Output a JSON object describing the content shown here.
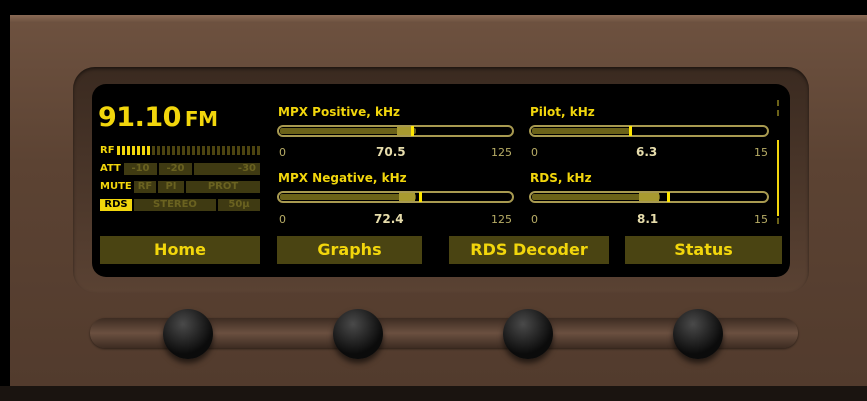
{
  "station": {
    "frequency": "91.10",
    "band": "FM"
  },
  "indicators": {
    "rf": "RF",
    "att": "ATT",
    "att_levels": [
      "-10",
      "-20",
      "-30"
    ],
    "mute": "MUTE",
    "mute_flags": [
      "RF",
      "PI",
      "PROT"
    ],
    "rds": "RDS",
    "stereo": "STEREO",
    "deemphasis": "50μ"
  },
  "meters": [
    {
      "label": "MPX Positive, kHz",
      "min": "0",
      "max": "125",
      "value": "70.5",
      "fraction": 0.564
    },
    {
      "label": "Pilot, kHz",
      "min": "0",
      "max": "15",
      "value": "6.3",
      "fraction": 0.42
    },
    {
      "label": "MPX Negative, kHz",
      "min": "0",
      "max": "125",
      "value": "72.4",
      "fraction": 0.579
    },
    {
      "label": "RDS, kHz",
      "min": "0",
      "max": "15",
      "value": "8.1",
      "fraction": 0.54
    }
  ],
  "softkeys": [
    "Home",
    "Graphs",
    "RDS Decoder",
    "Status"
  ],
  "colors": {
    "accent": "#f2d60c",
    "screen": "#000000",
    "panel": "#5c4333"
  }
}
